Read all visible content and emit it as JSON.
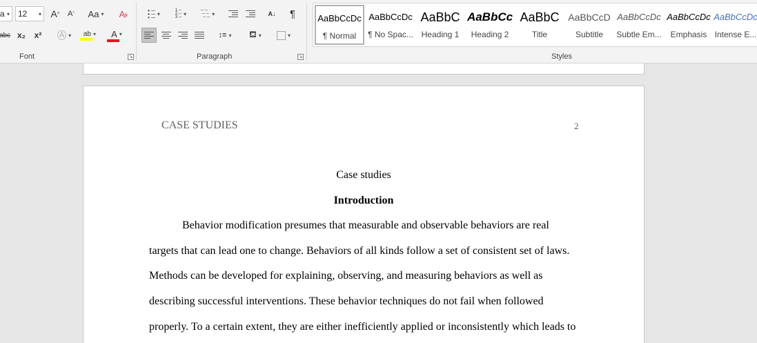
{
  "ribbon": {
    "font": {
      "name_value": "a",
      "size_value": "12",
      "grow_label": "A",
      "shrink_label": "A",
      "case_label": "Aa",
      "strike_label": "abc",
      "subscript_label": "x₂",
      "superscript_label": "x²",
      "effects_label": "A",
      "highlight_label": "ab",
      "color_label": "A",
      "group_label": "Font",
      "highlight_color": "#ffff00",
      "font_color": "#e81123"
    },
    "paragraph": {
      "group_label": "Paragraph",
      "pilcrow": "¶"
    },
    "styles": {
      "group_label": "Styles",
      "items": [
        {
          "preview": "AaBbCcDc",
          "name": "¶ Normal"
        },
        {
          "preview": "AaBbCcDc",
          "name": "¶ No Spac..."
        },
        {
          "preview": "AaBbC",
          "name": "Heading 1"
        },
        {
          "preview": "AaBbCc",
          "name": "Heading 2"
        },
        {
          "preview": "AaBbC",
          "name": "Title"
        },
        {
          "preview": "AaBbCcD",
          "name": "Subtitle"
        },
        {
          "preview": "AaBbCcDc",
          "name": "Subtle Em..."
        },
        {
          "preview": "AaBbCcDc",
          "name": "Emphasis"
        },
        {
          "preview": "AaBbCcDc",
          "name": "Intense E..."
        }
      ]
    }
  },
  "document": {
    "running_head": "CASE STUDIES",
    "page_number": "2",
    "title": "Case studies",
    "heading": "Introduction",
    "lines": [
      "Behavior modification presumes that measurable and observable behaviors are real",
      "targets that can lead one to change. Behaviors of all kinds follow a set of consistent set of laws.",
      "Methods can be developed for explaining, observing, and measuring behaviors as well as",
      "describing successful interventions. These behavior techniques do not fail when followed",
      "properly. To a certain extent, they are either inefficiently applied or inconsistently which leads to"
    ]
  }
}
